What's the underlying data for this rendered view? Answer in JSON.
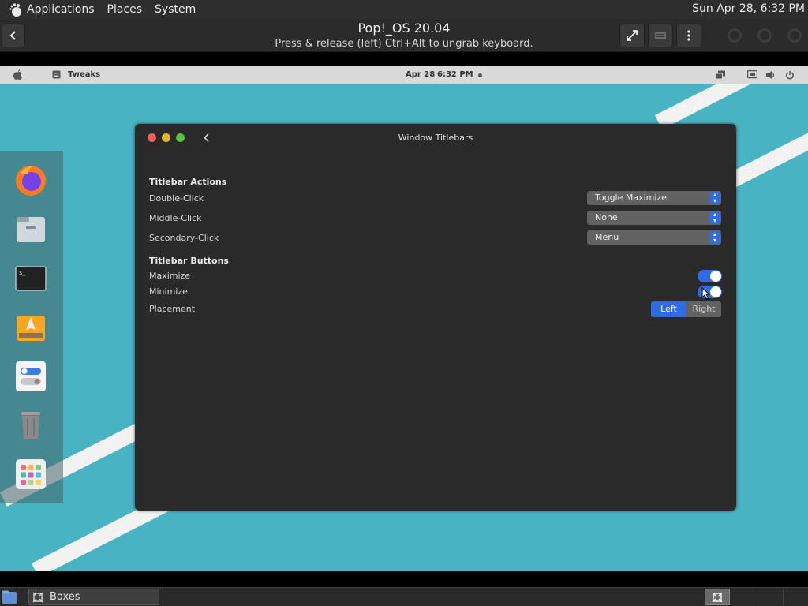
{
  "host_panel": {
    "menus": [
      "Applications",
      "Places",
      "System"
    ],
    "clock": "Sun Apr 28,  6:32 PM"
  },
  "boxes_header": {
    "title": "Pop!_OS 20.04",
    "subtitle": "Press & release (left) Ctrl+Alt to ungrab keyboard."
  },
  "guest_panel": {
    "app_name": "Tweaks",
    "date": "Apr 28",
    "time": "6:32 PM"
  },
  "dock": {
    "items": [
      "firefox",
      "files",
      "terminal",
      "installer",
      "tweaks",
      "trash",
      "app-grid"
    ]
  },
  "tweaks_window": {
    "title": "Window Titlebars",
    "titlebar_actions": {
      "heading": "Titlebar Actions",
      "rows": [
        {
          "label": "Double-Click",
          "value": "Toggle Maximize"
        },
        {
          "label": "Middle-Click",
          "value": "None"
        },
        {
          "label": "Secondary-Click",
          "value": "Menu"
        }
      ]
    },
    "titlebar_buttons": {
      "heading": "Titlebar Buttons",
      "maximize_label": "Maximize",
      "maximize_on": true,
      "minimize_label": "Minimize",
      "minimize_on": true,
      "placement_label": "Placement",
      "placement_options": [
        "Left",
        "Right"
      ],
      "placement_selected": "Left"
    }
  },
  "host_taskbar": {
    "task_label": "Boxes"
  },
  "colors": {
    "accent": "#2f6be4",
    "guest_wallpaper": "#47b3c3",
    "window_bg": "#2a2a2a",
    "close": "#ec5f5b",
    "minimize": "#e6b52b",
    "maximize": "#5fbe3c"
  }
}
